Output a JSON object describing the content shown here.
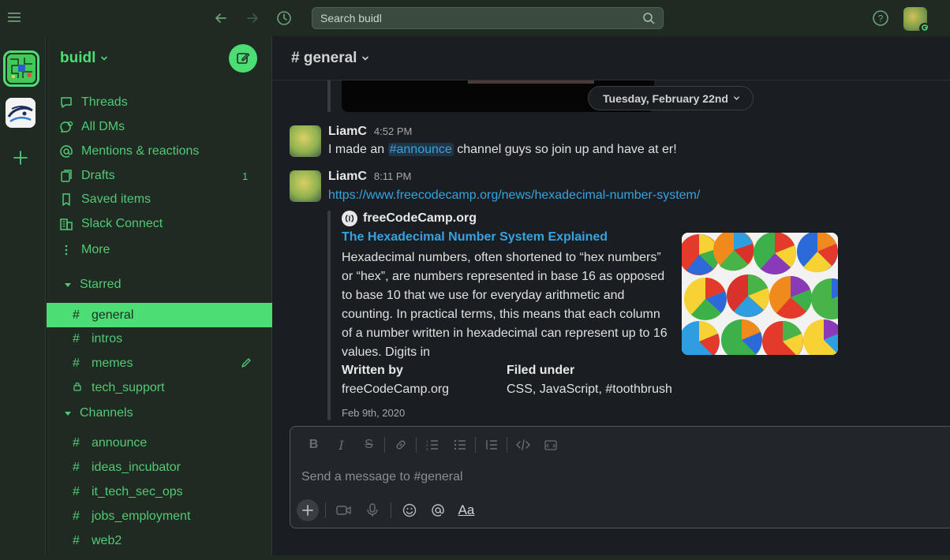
{
  "colors": {
    "accent": "#4cde74",
    "sidebar_bg": "#1e2a22",
    "main_bg": "#1a1d21",
    "link": "#36a3e0"
  },
  "topbar": {
    "search_placeholder": "Search buidl",
    "icons": [
      "menu-icon",
      "back-arrow-icon",
      "forward-arrow-icon",
      "history-icon",
      "search-icon",
      "help-icon"
    ]
  },
  "workspace": {
    "name": "buidl"
  },
  "sidebar": {
    "nav": [
      {
        "label": "Threads",
        "icon": "threads-icon"
      },
      {
        "label": "All DMs",
        "icon": "dms-icon"
      },
      {
        "label": "Mentions & reactions",
        "icon": "at-icon"
      },
      {
        "label": "Drafts",
        "icon": "drafts-icon",
        "count": "1"
      },
      {
        "label": "Saved items",
        "icon": "bookmark-icon"
      },
      {
        "label": "Slack Connect",
        "icon": "building-icon"
      },
      {
        "label": "More",
        "icon": "more-vertical-icon"
      }
    ],
    "starred_label": "Starred",
    "starred": [
      {
        "name": "general",
        "prefix": "#"
      },
      {
        "name": "intros",
        "prefix": "#"
      },
      {
        "name": "memes",
        "prefix": "#"
      },
      {
        "name": "tech_support",
        "prefix": "lock"
      }
    ],
    "channels_label": "Channels",
    "channels": [
      {
        "name": "announce"
      },
      {
        "name": "ideas_incubator"
      },
      {
        "name": "it_tech_sec_ops"
      },
      {
        "name": "jobs_employment"
      },
      {
        "name": "web2"
      }
    ]
  },
  "channel": {
    "title": "# general"
  },
  "date_divider": "Tuesday, February 22nd",
  "messages": [
    {
      "author": "LiamC",
      "time": "4:52 PM",
      "text_before": "I made an ",
      "mention": "#announce",
      "text_after": " channel guys so join up and have at er!"
    },
    {
      "author": "LiamC",
      "time": "8:11 PM",
      "link": "https://www.freecodecamp.org/news/hexadecimal-number-system/"
    }
  ],
  "unfurl": {
    "site": "freeCodeCamp.org",
    "title": "The Hexadecimal Number System Explained",
    "description": "Hexadecimal numbers, often shortened to “hex numbers” or “hex”, are numbers represented in base 16 as opposed to base 10 that we use for everyday arithmetic and counting. In practical terms, this means that each column of a number written in hexadecimal can represent up to 16 values. Digits in",
    "written_by_label": "Written by",
    "written_by": "freeCodeCamp.org",
    "filed_under_label": "Filed under",
    "filed_under": "CSS, JavaScript, #toothbrush",
    "date": "Feb 9th, 2020"
  },
  "composer": {
    "placeholder": "Send a message to #general",
    "format_label": "Aa"
  }
}
